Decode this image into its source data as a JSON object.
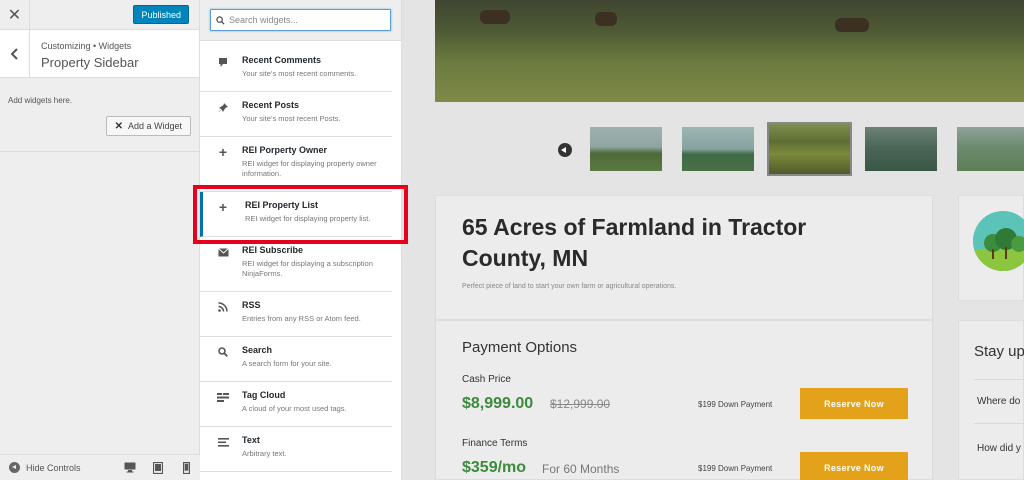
{
  "customizer": {
    "close_icon": "close-icon",
    "publish_label": "Published",
    "breadcrumb": "Customizing • Widgets",
    "title": "Property Sidebar",
    "note": "Add widgets here.",
    "add_widget_label": "Add a Widget",
    "hide_controls_label": "Hide Controls",
    "devices": [
      "desktop-icon",
      "tablet-icon",
      "mobile-icon"
    ]
  },
  "widget_panel": {
    "search_placeholder": "Search widgets...",
    "items": [
      {
        "title": "Recent Comments",
        "desc": "Your site’s most recent comments.",
        "icon": "comment-icon"
      },
      {
        "title": "Recent Posts",
        "desc": "Your site’s most recent Posts.",
        "icon": "pin-icon"
      },
      {
        "title": "REI Porperty Owner",
        "desc": "REI widget for displaying property owner information.",
        "icon": "plus-icon"
      },
      {
        "title": "REI Property List",
        "desc": "REI widget for displaying property list.",
        "icon": "plus-icon"
      },
      {
        "title": "REI Subscribe",
        "desc": "REI widget for displaying a subscription NinjaForms.",
        "icon": "envelope-icon"
      },
      {
        "title": "RSS",
        "desc": "Entries from any RSS or Atom feed.",
        "icon": "rss-icon"
      },
      {
        "title": "Search",
        "desc": "A search form for your site.",
        "icon": "search-icon"
      },
      {
        "title": "Tag Cloud",
        "desc": "A cloud of your most used tags.",
        "icon": "tag-cloud-icon"
      },
      {
        "title": "Text",
        "desc": "Arbitrary text.",
        "icon": "text-icon"
      }
    ],
    "highlight_color": "#e5001b"
  },
  "preview": {
    "property_title": "65 Acres of Farmland in Tractor County, MN",
    "property_subtitle": "Perfect piece of land to start your own farm or agricultural operations.",
    "payment_title": "Payment Options",
    "cash_label": "Cash Price",
    "cash_price": "$8,999.00",
    "cash_old_price": "$12,999.00",
    "cash_down": "$199 Down Payment",
    "finance_label": "Finance Terms",
    "finance_price": "$359/mo",
    "finance_term": "For 60 Months",
    "finance_down": "$199 Down Payment",
    "reserve_label": "Reserve Now",
    "stay_title": "Stay up",
    "q1": "Where do",
    "q2": "How did y",
    "accent_green": "#3b8a3e",
    "accent_orange": "#e3a21a"
  }
}
